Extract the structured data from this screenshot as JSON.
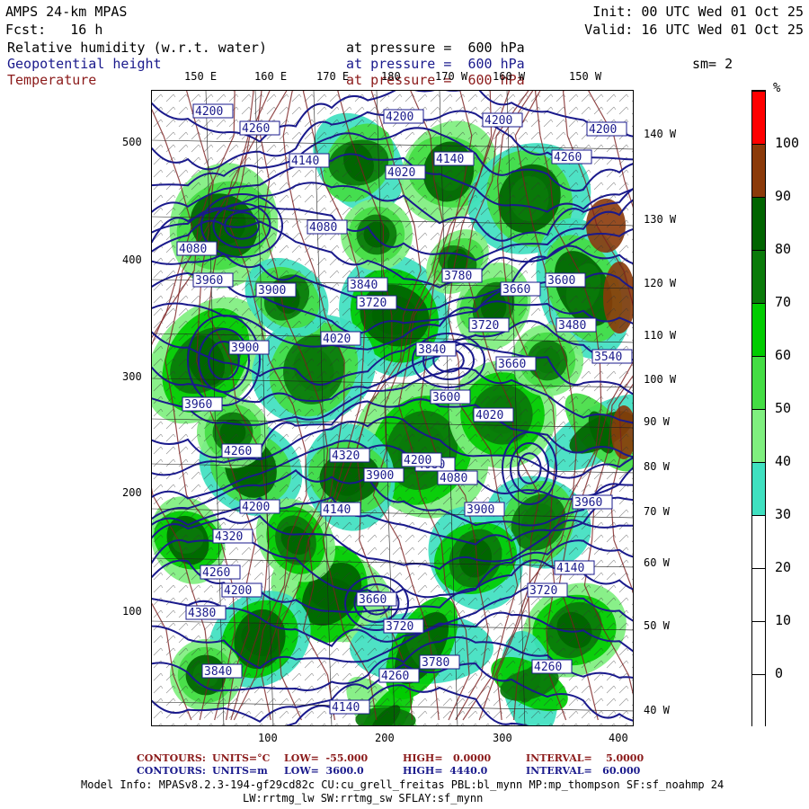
{
  "header": {
    "title": "AMPS 24-km MPAS",
    "init": "Init: 00 UTC Wed 01 Oct 25",
    "fcst": "Fcst:   16 h",
    "valid": "Valid: 16 UTC Wed 01 Oct 25",
    "field1": "Relative humidity (w.r.t. water)",
    "field1_level": "at pressure =  600 hPa",
    "field2": "Geopotential height",
    "field2_level": "at pressure =  600 hPa",
    "field3": "Temperature",
    "field3_level": "at pressure =  600 hPa",
    "smooth": "sm= 2"
  },
  "top_lon_labels": [
    "150 E",
    "160 E",
    "170 E",
    "180",
    "170 W",
    "160 W",
    "150 W"
  ],
  "right_lon_labels": [
    "140 W",
    "130 W",
    "120 W",
    "110 W",
    "100 W",
    "90 W",
    "80 W",
    "70 W",
    "60 W",
    "50 W",
    "40 W"
  ],
  "y_ticks": [
    "500",
    "400",
    "300",
    "200",
    "100"
  ],
  "x_ticks": [
    "100",
    "200",
    "300",
    "400"
  ],
  "colorbar": {
    "unit": "%",
    "labels": [
      "100",
      "90",
      "80",
      "70",
      "60",
      "50",
      "40",
      "30",
      "20",
      "10",
      "0"
    ],
    "colors": [
      "#ff0000",
      "#8b3a0a",
      "#006400",
      "#0a7a0a",
      "#00cc00",
      "#44dd44",
      "#7fef7f",
      "#3fe0c0",
      "#ffffff",
      "#ffffff",
      "#ffffff",
      "#ffffff"
    ]
  },
  "height_labels": [
    "4200",
    "4260",
    "4140",
    "4200",
    "4200",
    "4260",
    "4200",
    "4140",
    "4020",
    "4080",
    "3960",
    "3900",
    "3840",
    "3780",
    "3720",
    "3660",
    "3600",
    "3540",
    "3480",
    "4080",
    "4020",
    "3900",
    "3960",
    "3720",
    "3840",
    "3660",
    "4020",
    "4080",
    "3900",
    "3960",
    "4140",
    "4200",
    "4260",
    "4320",
    "4380",
    "4140",
    "4260",
    "4320",
    "4200",
    "4080",
    "3900",
    "3720",
    "3600",
    "3660",
    "3720",
    "3780",
    "3840",
    "4200",
    "4260",
    "4140",
    "4260"
  ],
  "footer": {
    "line1_label": "CONTOURS:",
    "line1_units": "UNITS=°C",
    "line1_low": "LOW=  -55.000",
    "line1_high": "HIGH=   0.0000",
    "line1_interval": "INTERVAL=    5.0000",
    "line2_label": "CONTOURS:",
    "line2_units": "UNITS=m",
    "line2_low": "LOW=  3600.0",
    "line2_high": "HIGH=  4440.0",
    "line2_interval": "INTERVAL=   60.000",
    "model_info": "Model Info: MPASv8.2.3-194-gf29cd82c CU:cu_grell_freitas PBL:bl_mynn MP:mp_thompson SF:sf_noahmp 24",
    "model_info2": "LW:rrtmg_lw SW:rrtmg_sw SFLAY:sf_mynn"
  }
}
